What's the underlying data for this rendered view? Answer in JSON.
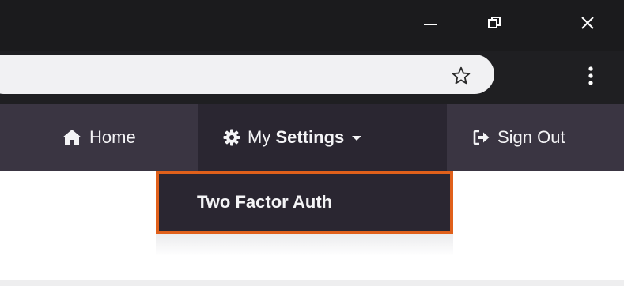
{
  "window": {
    "minimize_icon": "minimize-icon",
    "restore_icon": "restore-icon",
    "close_icon": "close-icon"
  },
  "browser": {
    "address_value": "",
    "bookmark_icon": "star-icon",
    "menu_icon": "more-vertical-icon"
  },
  "nav": {
    "home": {
      "label": "Home",
      "icon": "home-icon"
    },
    "settings": {
      "prefix": "My",
      "label": "Settings",
      "icon": "gear-icon",
      "caret_icon": "caret-down-icon"
    },
    "signout": {
      "label": "Sign Out",
      "icon": "sign-out-icon"
    }
  },
  "dropdown": {
    "items": [
      {
        "label": "Two Factor Auth"
      }
    ]
  },
  "colors": {
    "titlebar": "#1b1b1d",
    "navbar": "#3a3542",
    "active": "#2a2631",
    "highlight": "#e0601b"
  }
}
